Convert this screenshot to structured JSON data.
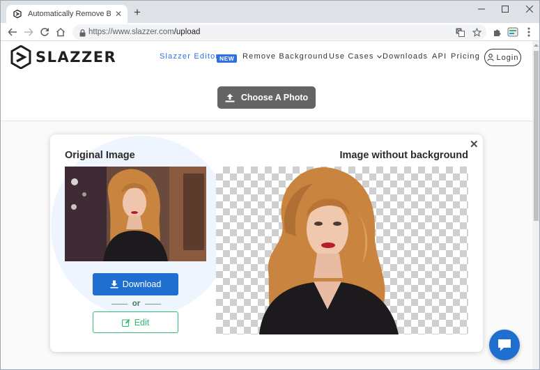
{
  "browser": {
    "tab_title": "Automatically Remove Backgro",
    "url_host": "https://www.slazzer.com",
    "url_path": "/upload"
  },
  "header": {
    "brand": "SLAZZER",
    "nav": {
      "editor": "Slazzer Editor",
      "new_badge": "NEW",
      "remove_background": "Remove Background",
      "use_cases": "Use Cases",
      "downloads": "Downloads",
      "api": "API",
      "pricing": "Pricing",
      "login": "Login"
    }
  },
  "upload": {
    "choose_label": "Choose A Photo"
  },
  "result_card": {
    "original_heading": "Original Image",
    "result_heading": "Image without background",
    "download_label": "Download",
    "or_text": "or",
    "edit_label": "Edit"
  },
  "colors": {
    "accent_blue": "#1f6fd1",
    "edit_green": "#2eb872",
    "choose_gray": "#646464"
  },
  "icons": [
    "translate-icon",
    "star-icon",
    "extensions-icon",
    "profile-icon",
    "menu-icon",
    "lock-icon",
    "upload-icon",
    "download-icon",
    "edit-icon",
    "chat-icon",
    "user-icon"
  ]
}
